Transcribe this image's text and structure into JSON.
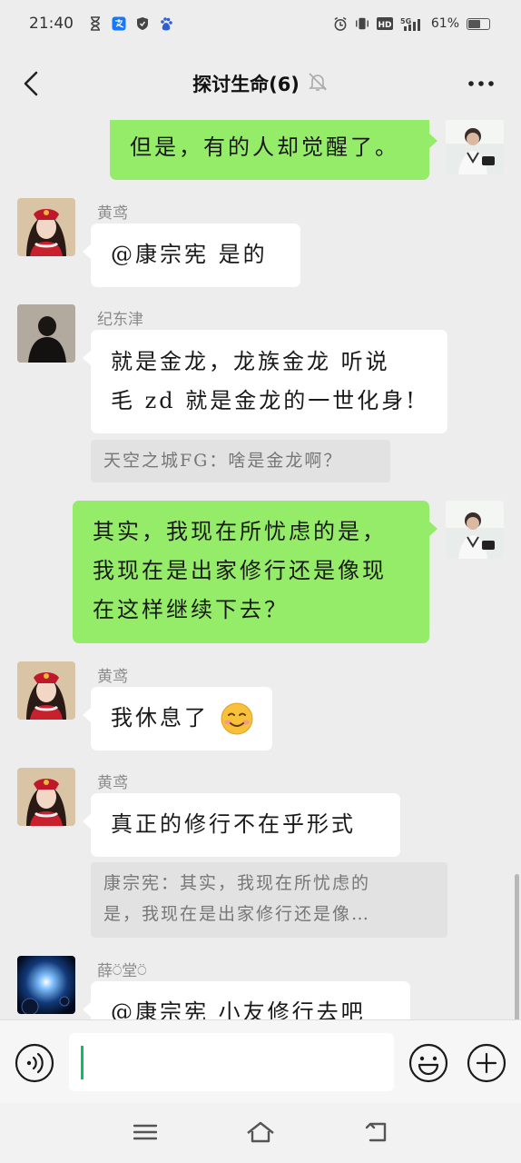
{
  "status_bar": {
    "time": "21:40",
    "left_icons": [
      "hourglass-icon",
      "alipay-icon",
      "shield-icon",
      "baidu-icon"
    ],
    "right_icons": [
      "alarm-icon",
      "vibrate-icon",
      "hd-icon",
      "signal-5g-icon"
    ],
    "hd_label": "HD",
    "network_label": "5G",
    "battery_percent_text": "61%",
    "battery_level": 0.61
  },
  "header": {
    "title": "探讨生命(6)",
    "muted": true
  },
  "messages": [
    {
      "direction": "out",
      "text": "但是，有的人却觉醒了。"
    },
    {
      "direction": "in",
      "sender": "黄鸢",
      "text": "@康宗宪  是的"
    },
    {
      "direction": "in",
      "sender": "纪东津",
      "lines": [
        "就是金龙，龙族金龙  听说",
        "毛 zd 就是金龙的一世化身!"
      ],
      "quote": "天空之城FG：啥是金龙啊？"
    },
    {
      "direction": "out",
      "lines": [
        "其实，我现在所忧虑的是，",
        "我现在是出家修行还是像现",
        "在这样继续下去？"
      ]
    },
    {
      "direction": "in",
      "sender": "黄鸢",
      "text": "我休息了",
      "emoji": "smiling-face-emoji"
    },
    {
      "direction": "in",
      "sender": "黄鸢",
      "text": "真正的修行不在乎形式",
      "quote_lines": [
        "康宗宪：其实，我现在所忧虑的",
        "是，我现在是出家修行还是像…"
      ]
    },
    {
      "direction": "in",
      "sender": "薛⍥堂⍥",
      "text": "@康宗宪  小友修行去吧"
    }
  ],
  "input_bar": {
    "voice_icon": "voice-icon",
    "input_value": "",
    "emoji_icon": "smiley-icon",
    "plus_icon": "plus-icon"
  },
  "nav_bar": {
    "icons": [
      "menu-icon",
      "home-icon",
      "back-icon"
    ]
  },
  "colors": {
    "background": "#ededed",
    "outgoing_bubble": "#95ec69",
    "incoming_bubble": "#ffffff",
    "quote_bg": "#e2e2e2",
    "accent": "#07c160"
  }
}
